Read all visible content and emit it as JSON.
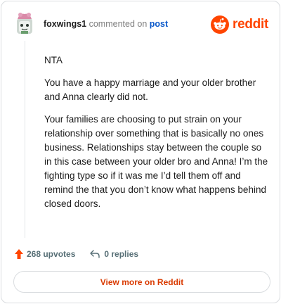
{
  "header": {
    "username": "foxwings1",
    "action": "commented on",
    "post_link": "post",
    "brand": "reddit",
    "avatar_icon": "snoo-avatar-icon",
    "brand_icon": "reddit-snoo-icon"
  },
  "comment": {
    "paragraphs": [
      "NTA",
      "You have a happy marriage and your older brother and Anna clearly did not.",
      "Your families are choosing to put strain on your relationship over something that is basically no ones business. Relationships stay between the couple so in this case between your older bro and Anna! I’m the fighting type so if it was me I’d tell them off and remind the that you don’t know what happens behind closed doors."
    ]
  },
  "footer": {
    "upvotes": "268 upvotes",
    "replies": "0 replies",
    "upvote_icon": "upvote-arrow-icon",
    "reply_icon": "reply-arrow-icon"
  },
  "cta": {
    "label": "View more on Reddit"
  },
  "colors": {
    "brand": "#ff4500",
    "link": "#0a58ca",
    "muted": "#576f76"
  }
}
